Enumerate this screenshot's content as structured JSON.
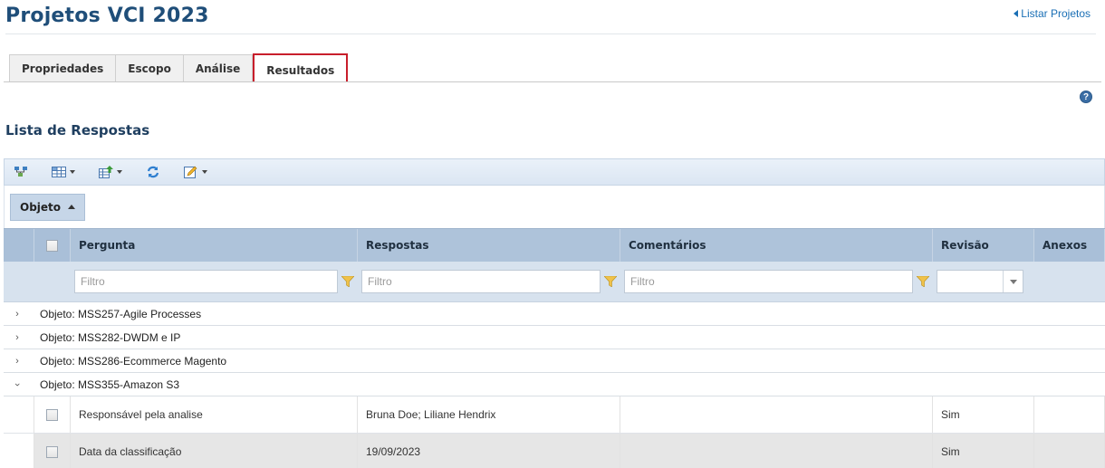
{
  "page": {
    "title": "Projetos VCI 2023",
    "list_link": "Listar Projetos",
    "help_glyph": "?"
  },
  "tabs": [
    {
      "label": "Propriedades",
      "active": false
    },
    {
      "label": "Escopo",
      "active": false
    },
    {
      "label": "Análise",
      "active": false
    },
    {
      "label": "Resultados",
      "active": true
    }
  ],
  "section": {
    "title": "Lista de Respostas"
  },
  "toolbar": {
    "buttons": [
      {
        "icon": "hierarchy-icon",
        "has_menu": false
      },
      {
        "icon": "grid-columns-icon",
        "has_menu": true
      },
      {
        "icon": "export-icon",
        "has_menu": true
      },
      {
        "icon": "refresh-icon",
        "has_menu": false
      },
      {
        "icon": "edit-icon",
        "has_menu": true
      }
    ]
  },
  "grouping": {
    "chip_label": "Objeto"
  },
  "columns": {
    "pergunta": "Pergunta",
    "respostas": "Respostas",
    "comentarios": "Comentários",
    "revisao": "Revisão",
    "anexos": "Anexos"
  },
  "filters": {
    "pergunta_placeholder": "Filtro",
    "respostas_placeholder": "Filtro",
    "comentarios_placeholder": "Filtro",
    "revisao_value": ""
  },
  "groups": [
    {
      "label": "Objeto: MSS257-Agile Processes",
      "expanded": false
    },
    {
      "label": "Objeto: MSS282-DWDM e IP",
      "expanded": false
    },
    {
      "label": "Objeto: MSS286-Ecommerce Magento",
      "expanded": false
    },
    {
      "label": "Objeto: MSS355-Amazon S3",
      "expanded": true
    }
  ],
  "rows": [
    {
      "pergunta": "Responsável pela analise",
      "respostas": "Bruna Doe; Liliane Hendrix",
      "comentarios": "",
      "revisao": "Sim",
      "anexos": ""
    },
    {
      "pergunta": "Data da classificação",
      "respostas": "19/09/2023",
      "comentarios": "",
      "revisao": "Sim",
      "anexos": ""
    }
  ],
  "colors": {
    "title": "#1f4e79",
    "link": "#1a6fb5",
    "active_tab_border": "#c81e2b",
    "header_bg": "#a9bfd8",
    "filter_bg": "#d7e2ee",
    "toolbar_bg": "#dbe6f3"
  }
}
